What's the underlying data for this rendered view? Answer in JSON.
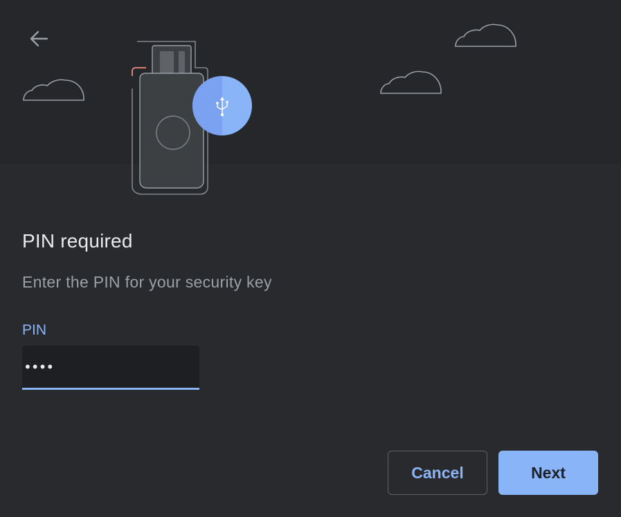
{
  "dialog": {
    "title": "PIN required",
    "subtitle": "Enter the PIN for your security key"
  },
  "pin": {
    "label": "PIN",
    "masked_value": "••••"
  },
  "buttons": {
    "cancel_label": "Cancel",
    "next_label": "Next"
  },
  "icons": {
    "back": "arrow-left-icon",
    "usb": "usb-icon",
    "security_key": "security-key-illustration",
    "cloud": "cloud-icon"
  },
  "colors": {
    "accent": "#8ab4f8",
    "background": "#292a2d",
    "text_primary": "#e8eaed",
    "text_secondary": "#9aa0a6",
    "field_bg": "#1e1f22",
    "border": "#5f6368",
    "alert": "#f28b82"
  }
}
